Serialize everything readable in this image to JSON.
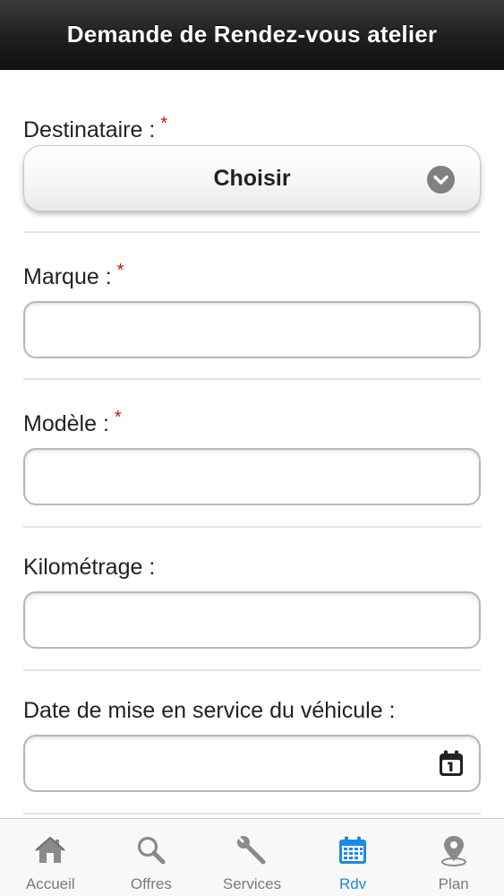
{
  "header": {
    "title": "Demande de Rendez-vous atelier"
  },
  "form": {
    "required_marker": "*",
    "destinataire": {
      "label": "Destinataire :",
      "required": true,
      "select_value": "Choisir"
    },
    "marque": {
      "label": "Marque :",
      "required": true,
      "value": ""
    },
    "modele": {
      "label": "Modèle :",
      "required": true,
      "value": ""
    },
    "kilometrage": {
      "label": "Kilométrage :",
      "required": false,
      "value": ""
    },
    "date_mise_en_service": {
      "label": "Date de mise en service du véhicule :",
      "required": false,
      "value": ""
    }
  },
  "tabbar": {
    "items": [
      {
        "label": "Accueil",
        "icon": "home-icon",
        "active": false
      },
      {
        "label": "Offres",
        "icon": "search-icon",
        "active": false
      },
      {
        "label": "Services",
        "icon": "wrench-icon",
        "active": false
      },
      {
        "label": "Rdv",
        "icon": "calendar-icon",
        "active": true
      },
      {
        "label": "Plan",
        "icon": "map-pin-icon",
        "active": false
      }
    ]
  },
  "colors": {
    "header_bg": "#1e1e1e",
    "required": "#cc1111",
    "tab_active": "#1e88e5",
    "tab_inactive": "#7a7a7a"
  }
}
